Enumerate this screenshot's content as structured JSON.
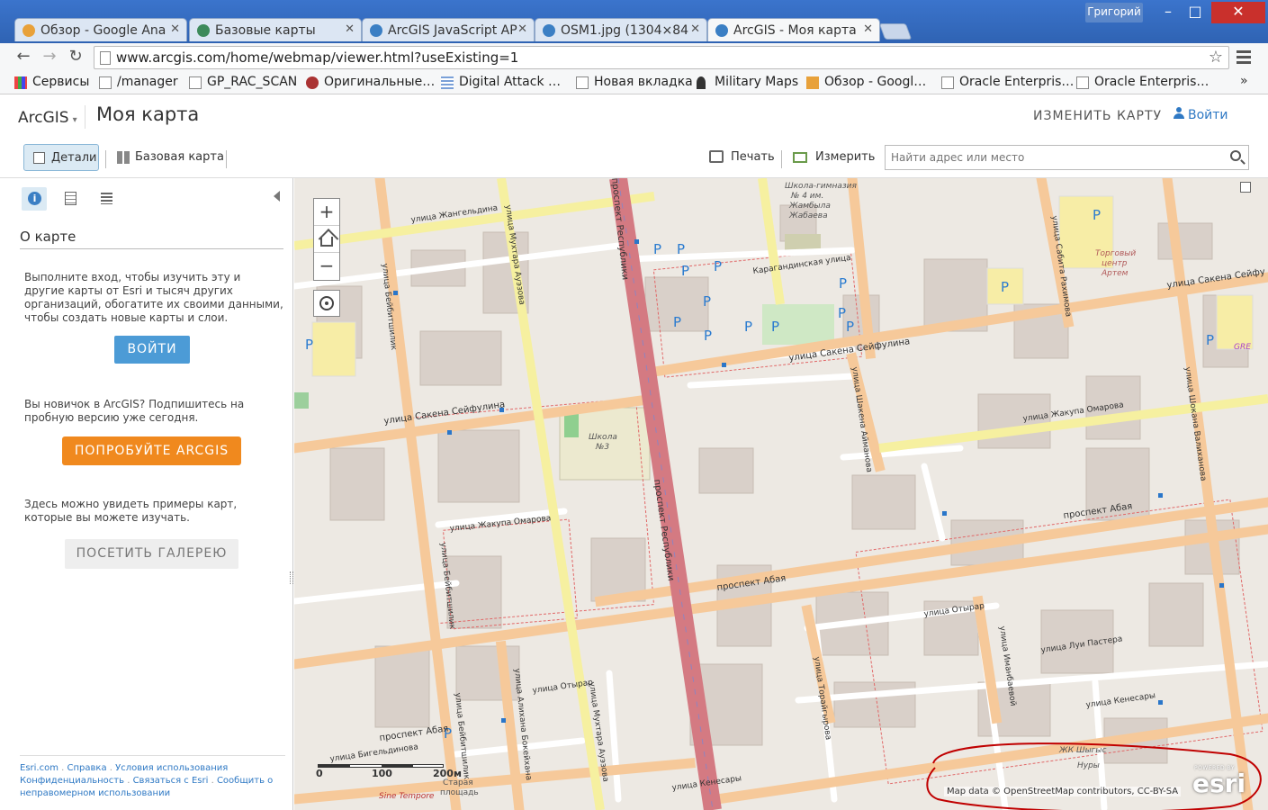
{
  "browser": {
    "tabs": [
      {
        "title": "Обзор - Google Ana",
        "active": false,
        "favicon_color": "#e8a13a"
      },
      {
        "title": "Базовые карты",
        "active": false,
        "favicon_color": "#3d8a5a"
      },
      {
        "title": "ArcGIS JavaScript AP",
        "active": false,
        "favicon_color": "#3b7fc4"
      },
      {
        "title": "OSM1.jpg (1304×84",
        "active": false,
        "favicon_color": "#3b7fc4"
      },
      {
        "title": "ArcGIS - Моя карта",
        "active": true,
        "favicon_color": "#3b7fc4"
      }
    ],
    "user_badge": "Григорий",
    "window_controls": {
      "minimize": "–",
      "maximize": "□",
      "close": "✕"
    },
    "url": "www.arcgis.com/home/webmap/viewer.html?useExisting=1",
    "nav": {
      "back": "←",
      "forward": "→",
      "reload": "↻"
    },
    "bookmarks": [
      "Сервисы",
      "/manager",
      "GP_RAC_SCAN",
      "Оригинальные…",
      "Digital Attack …",
      "Новая вкладка",
      "Military Maps",
      "Обзор - Googl…",
      "Oracle Enterpris…",
      "Oracle Enterpris…"
    ],
    "bookmarks_more": "»"
  },
  "app": {
    "logo": "ArcGIS",
    "logo_caret": "▾",
    "map_title": "Моя карта",
    "edit_map": "ИЗМЕНИТЬ КАРТУ",
    "sign_in_top": "Войти"
  },
  "toolbar": {
    "details": "Детали",
    "basemap": "Базовая карта",
    "print": "Печать",
    "measure": "Измерить",
    "search_placeholder": "Найти адрес или место"
  },
  "panel": {
    "about_title": "О карте",
    "signin_text": "Выполните вход, чтобы изучить эту и другие карты от Esri и тысяч других организаций, обогатите их своими данными, чтобы создать новые карты и слои.",
    "signin_button": "ВОЙТИ",
    "new_user_text": "Вы новичок в ArcGIS? Подпишитесь на пробную версию уже сегодня.",
    "try_button": "ПОПРОБУЙТЕ ARCGIS",
    "gallery_text": "Здесь можно увидеть примеры карт, которые вы можете изучать.",
    "gallery_button": "ПОСЕТИТЬ ГАЛЕРЕЮ",
    "footer_links": [
      "Esri.com",
      "Справка",
      "Условия использования",
      "Конфиденциальность",
      "Связаться с Esri",
      "Сообщить о неправомерном использовании"
    ]
  },
  "map": {
    "zoom_in": "+",
    "zoom_out": "−",
    "street_labels": [
      "улица Жангельдина",
      "улица Мухтара Ауэзова",
      "улица Бейбитшилик",
      "проспект Республики",
      "Карагандинская улица",
      "улица Сакена Сейфулина",
      "улица Шакена Айманова",
      "улица Сабита Рахимова",
      "улица Жакупа Омарова",
      "улица Шокана Валиханова",
      "проспект Абая",
      "улица Отырар",
      "улица Луи Пастера",
      "улица Иманбаевой",
      "улица Торайгырова",
      "улица Кенесары",
      "улица Алихана Бокейхана",
      "улица Бигельдинова"
    ],
    "poi_labels": [
      "Школа-гимназия № 4 им. Жамбыла Жабаева",
      "Торговый центр Артем",
      "Школа №3",
      "ЖК Шыгыс Нуры",
      "Старая площадь",
      "Sine Tempore",
      "GRE"
    ],
    "parking": "P",
    "scale_labels": [
      "0",
      "100",
      "200м"
    ],
    "attribution": "Map data © OpenStreetMap contributors, CC-BY-SA",
    "esri_powered": "POWERED BY",
    "esri_name": "esri",
    "annotation_color": "#c00000"
  }
}
